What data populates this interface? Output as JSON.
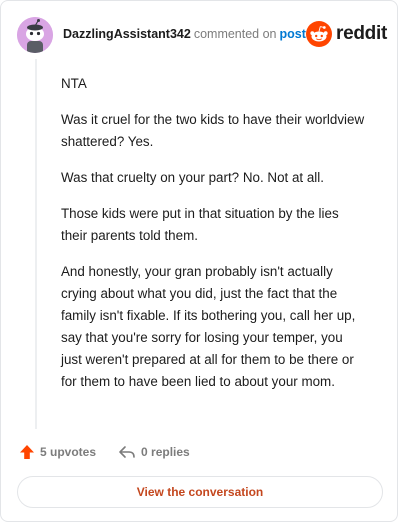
{
  "header": {
    "username": "DazzlingAssistant342",
    "action_text": "commented on",
    "post_link": "post",
    "logo_text": "reddit"
  },
  "comment": {
    "paragraphs": [
      "NTA",
      "Was it cruel for the two kids to have their worldview shattered? Yes.",
      "Was that cruelty on your part? No. Not at all.",
      "Those kids were put in that situation by the lies their parents told them.",
      "And honestly, your gran probably isn't actually crying about what you did, just the fact that the family isn't fixable. If its bothering you, call her up, say that you're sorry for losing your temper, you just weren't prepared at all for them to be there or for them to have been lied to about your mom."
    ]
  },
  "footer": {
    "upvotes": "5 upvotes",
    "replies": "0 replies"
  },
  "actions": {
    "view_conversation": "View the conversation"
  },
  "colors": {
    "brand_orange": "#ff4500",
    "link_blue": "#0079d3",
    "button_text": "#c4471e",
    "avatar_bg": "#d9a5e4"
  },
  "icons": {
    "avatar": "snoo-avatar-icon",
    "logo": "reddit-logo-icon",
    "upvote": "upvote-arrow-icon",
    "reply": "reply-arrow-icon"
  }
}
